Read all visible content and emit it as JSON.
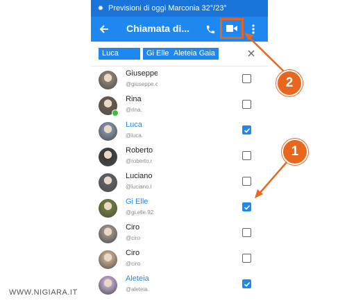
{
  "status_bar": {
    "text": "Previsioni di oggi Marconia 32°/23°",
    "icon": "sun-icon"
  },
  "app_bar": {
    "title": "Chiamata di...",
    "back_icon": "arrow-left-icon",
    "call_icon": "phone-icon",
    "video_icon": "video-camera-icon",
    "more_icon": "more-vertical-icon"
  },
  "selected_chips": [
    "Luca",
    "Gi Elle",
    "Aleteia Gaia"
  ],
  "contacts": [
    {
      "name": "Giuseppe",
      "handle": "@giuseppe.c",
      "checked": false,
      "online": false,
      "color": "#8a7f74"
    },
    {
      "name": "Rina",
      "handle": "@rina.",
      "checked": false,
      "online": true,
      "color": "#6b5a4e"
    },
    {
      "name": "Luca",
      "handle": "@luca.",
      "checked": true,
      "online": false,
      "color": "#7d8fa3"
    },
    {
      "name": "Roberto",
      "handle": "@roberto.r",
      "checked": false,
      "online": false,
      "color": "#3a3a3a"
    },
    {
      "name": "Luciano",
      "handle": "@luciano.l",
      "checked": false,
      "online": false,
      "color": "#5a5f66"
    },
    {
      "name": "Gi Elle",
      "handle": "@gi.elle.92",
      "checked": true,
      "online": false,
      "color": "#6d7a3c"
    },
    {
      "name": "Ciro",
      "handle": "@ciro",
      "checked": false,
      "online": false,
      "color": "#9a8f88"
    },
    {
      "name": "Ciro",
      "handle": "@ciro",
      "checked": false,
      "online": false,
      "color": "#c2a48a"
    },
    {
      "name": "Aleteia",
      "handle": "@aleteia.",
      "checked": true,
      "online": false,
      "color": "#b7a3c9"
    }
  ],
  "annotations": {
    "badge_1": "1",
    "badge_2": "2"
  },
  "watermark": "WWW.NIGIARA.IT",
  "colors": {
    "accent": "#1e88f0",
    "status_bar": "#1a73d9",
    "highlight": "#e5621f"
  }
}
